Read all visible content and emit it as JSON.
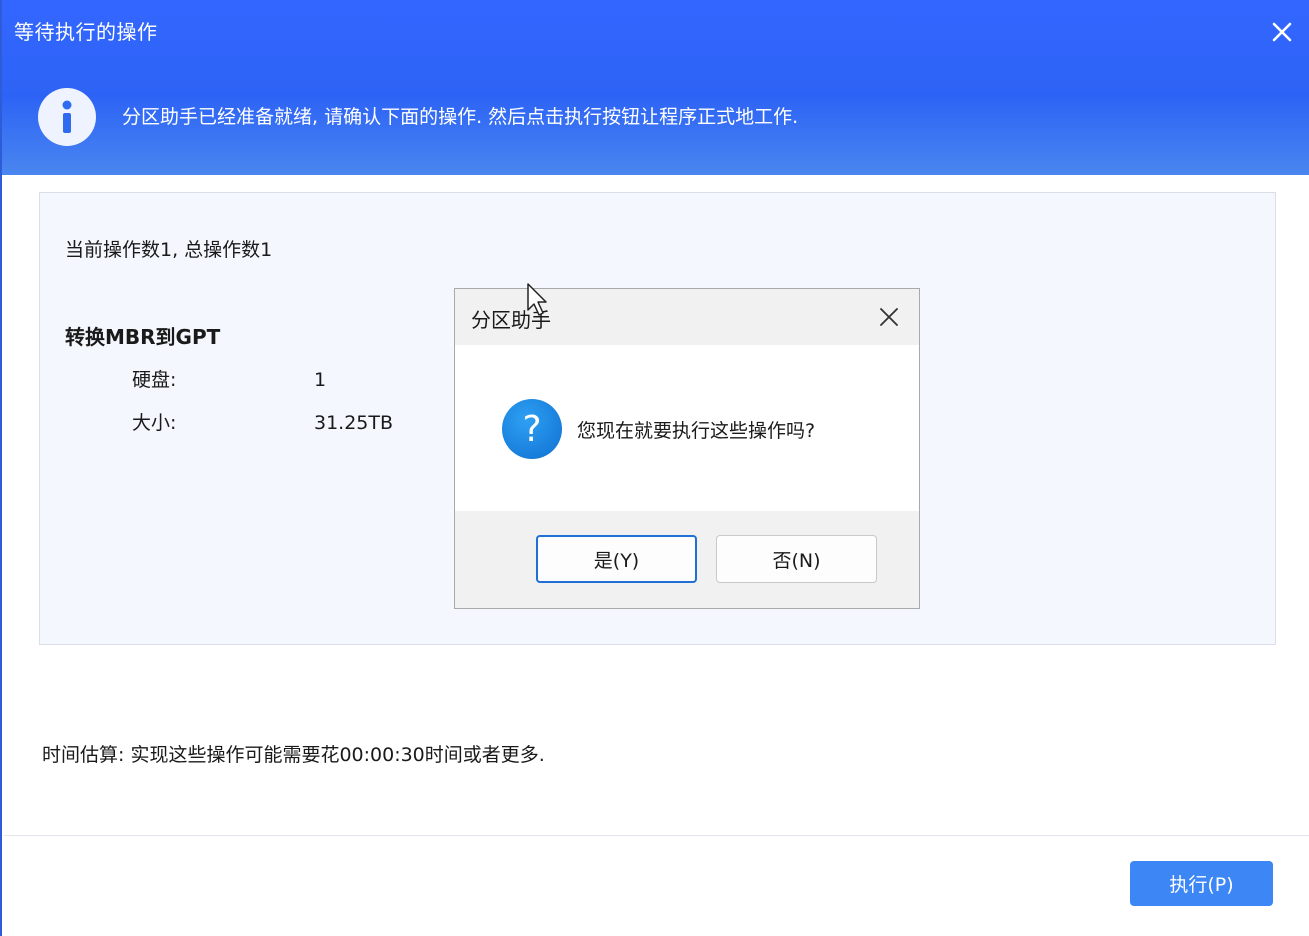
{
  "window": {
    "title": "等待执行的操作",
    "close_icon": "close-icon",
    "header_message": "分区助手已经准备就绪, 请确认下面的操作. 然后点击执行按钮让程序正式地工作.",
    "info_icon": "info-icon"
  },
  "operations": {
    "count_text": "当前操作数1, 总操作数1",
    "items": [
      {
        "title": "转换MBR到GPT",
        "rows": [
          {
            "label": "硬盘:",
            "value": "1"
          },
          {
            "label": "大小:",
            "value": "31.25TB"
          }
        ]
      }
    ]
  },
  "time_estimate": "时间估算: 实现这些操作可能需要花00:00:30时间或者更多.",
  "execute_button": "执行(P)",
  "dialog": {
    "title": "分区助手",
    "message": "您现在就要执行这些操作吗?",
    "icon": "question-icon",
    "yes_label": "是(Y)",
    "no_label": "否(N)"
  },
  "colors": {
    "header_blue": "#2d63f5",
    "execute_blue": "#3c86f5",
    "panel_bg": "#f4f7fd",
    "dialog_focus_border": "#1f6fd6"
  }
}
